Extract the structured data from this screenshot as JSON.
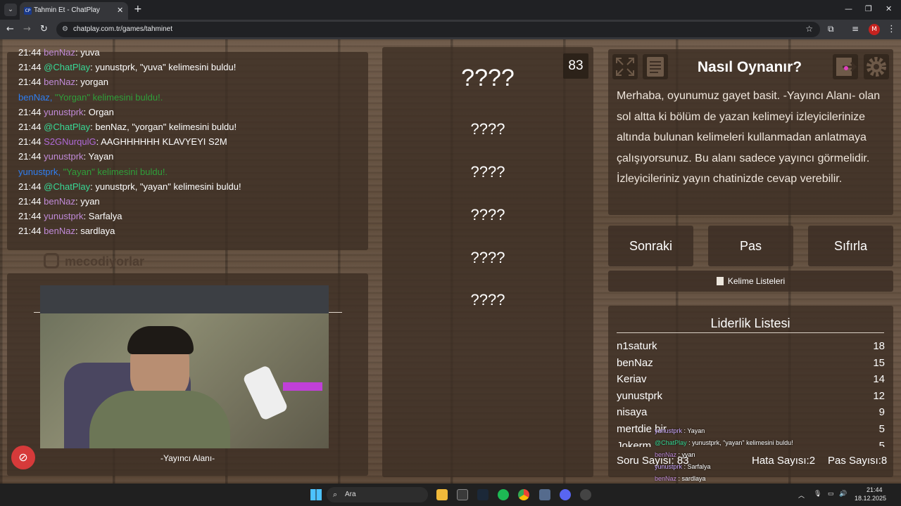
{
  "browser": {
    "tab_title": "Tahmin Et - ChatPlay",
    "favicon_text": "CP",
    "url": "chatplay.com.tr/games/tahminet",
    "profile_initial": "M"
  },
  "chat": [
    {
      "time": "21:44",
      "user": "benNaz",
      "user_color": "#c08ad8",
      "text": ": yuva"
    },
    {
      "time": "21:44",
      "user": "@ChatPlay",
      "user_color": "#38d996",
      "text": ": yunustprk, \"yuva\" kelimesini buldu!"
    },
    {
      "time": "21:44",
      "user": "benNaz",
      "user_color": "#c08ad8",
      "text": ": yorgan"
    },
    {
      "time": "",
      "user": "benNaz, ",
      "user_color": "#2f7ef0",
      "text": "\"Yorgan\" kelimesini buldu!.",
      "system": true
    },
    {
      "time": "21:44",
      "user": "yunustprk",
      "user_color": "#c08ad8",
      "text": ": Organ"
    },
    {
      "time": "21:44",
      "user": "@ChatPlay",
      "user_color": "#38d996",
      "text": ": benNaz, \"yorgan\" kelimesini buldu!"
    },
    {
      "time": "21:44",
      "user": "S2GNurqulG",
      "user_color": "#b06ad8",
      "text": ": AAGHHHHHH KLAVYEYI S2M"
    },
    {
      "time": "21:44",
      "user": "yunustprk",
      "user_color": "#c08ad8",
      "text": ": Yayan"
    },
    {
      "time": "",
      "user": "yunustprk, ",
      "user_color": "#2f7ef0",
      "text": "\"Yayan\" kelimesini buldu!.",
      "system": true
    },
    {
      "time": "21:44",
      "user": "@ChatPlay",
      "user_color": "#38d996",
      "text": ": yunustprk, \"yayan\" kelimesini buldu!"
    },
    {
      "time": "21:44",
      "user": "benNaz",
      "user_color": "#c08ad8",
      "text": ": yyan"
    },
    {
      "time": "21:44",
      "user": "yunustprk",
      "user_color": "#c08ad8",
      "text": ": Sarfalya"
    },
    {
      "time": "21:44",
      "user": "benNaz",
      "user_color": "#c08ad8",
      "text": ": sardlaya"
    }
  ],
  "streamer": {
    "instagram": "mecodiyorlar",
    "cam_label": "-Yayıncı Alanı-"
  },
  "words": {
    "counter": "83",
    "main": "????",
    "others": [
      "????",
      "????",
      "????",
      "????",
      "????"
    ]
  },
  "help": {
    "title": "Nasıl Oynanır?",
    "body": "Merhaba, oyunumuz gayet basit. -Yayıncı Alanı- olan sol altta ki bölüm de yazan kelimeyi izleyicilerinize altında bulunan kelimeleri kullanmadan anlatmaya çalışıyorsunuz. Bu alanı sadece yayıncı görmelidir. İzleyicileriniz yayın chatinizde cevap verebilir."
  },
  "controls": {
    "next": "Sonraki",
    "pass": "Pas",
    "reset": "Sıfırla",
    "word_lists": "Kelime Listeleri"
  },
  "leaderboard": {
    "title": "Liderlik Listesi",
    "rows": [
      {
        "name": "n1saturk",
        "score": "18"
      },
      {
        "name": "benNaz",
        "score": "15"
      },
      {
        "name": "Keriav",
        "score": "14"
      },
      {
        "name": "yunustprk",
        "score": "12"
      },
      {
        "name": "nisaya",
        "score": "9"
      },
      {
        "name": "mertdie bir",
        "score": "5"
      },
      {
        "name": "Jokerm...",
        "score": "5"
      }
    ]
  },
  "stats": {
    "questions_label": "Soru Sayısı:",
    "questions": "83",
    "errors_label": "Hata Sayısı:",
    "errors": "2",
    "passes_label": "Pas Sayısı:",
    "passes": "8"
  },
  "overlay_chat": [
    {
      "user": "yunustprk",
      "user_color": "#c9a7ff",
      "text": ": Yayan"
    },
    {
      "user": "@ChatPlay",
      "user_color": "#38d996",
      "text": ": yunustprk, \"yayan\" kelimesini buldu!"
    },
    {
      "user": "benNaz",
      "user_color": "#c08ad8",
      "text": ": yyan"
    },
    {
      "user": "yunustprk",
      "user_color": "#c9a7ff",
      "text": ": Sarfalya"
    },
    {
      "user": "benNaz",
      "user_color": "#c08ad8",
      "text": ": sardlaya"
    }
  ],
  "taskbar": {
    "search_placeholder": "Ara",
    "time": "21:44",
    "date": "18.12.2025"
  }
}
